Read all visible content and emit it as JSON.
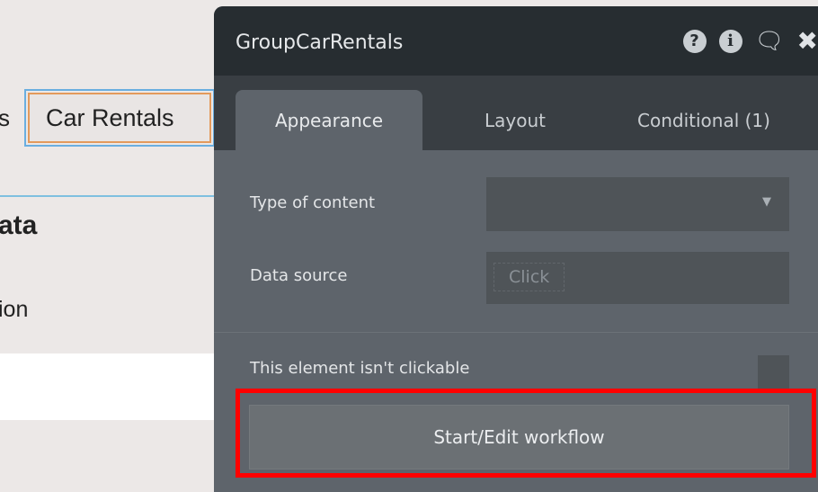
{
  "canvas": {
    "partial_tab_text": "s",
    "selected_element_label": "Car Rentals",
    "partial_heading": "ata",
    "partial_text": "ion"
  },
  "panel": {
    "title": "GroupCarRentals",
    "header_icons": [
      "help-icon",
      "info-icon",
      "comment-icon",
      "close-icon"
    ],
    "tabs": [
      {
        "label": "Appearance",
        "active": true
      },
      {
        "label": "Layout"
      },
      {
        "label": "Conditional (1)"
      }
    ],
    "type_of_content": {
      "label": "Type of content",
      "value": ""
    },
    "data_source": {
      "label": "Data source",
      "placeholder": "Click"
    },
    "not_clickable": {
      "label": "This element isn't clickable",
      "checked": false
    },
    "workflow_button": "Start/Edit workflow",
    "highlight_color": "#ff0000"
  }
}
